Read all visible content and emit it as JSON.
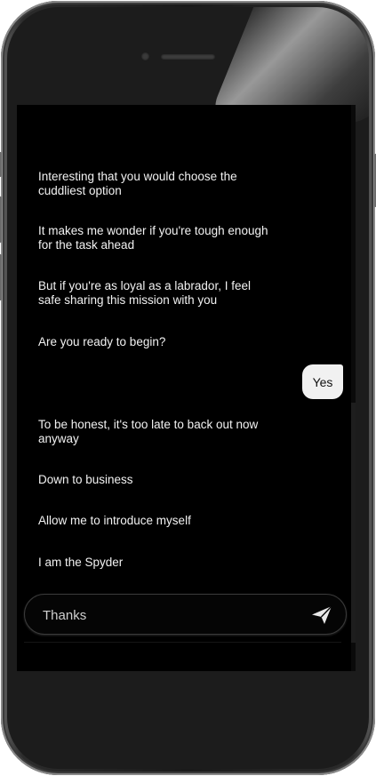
{
  "conversation": {
    "messages": [
      {
        "text": "Interesting that you would choose the cuddliest option"
      },
      {
        "text": "It makes me wonder if you're tough enough for the task ahead"
      },
      {
        "text": "But if you're as loyal as a labrador, I feel safe sharing this mission with you"
      },
      {
        "text": "Are you ready to begin?"
      },
      {
        "text": "To be honest, it's too late to back out now anyway"
      },
      {
        "text": "Down to business"
      },
      {
        "text": "Allow me to introduce myself"
      },
      {
        "text": "I am the Spyder"
      }
    ],
    "user_reply": "Yes"
  },
  "composer": {
    "value": "Thanks",
    "send_icon": "send-icon"
  },
  "colors": {
    "screen_background": "#000000",
    "bot_text": "#f2f2f2",
    "user_bubble": "#f1f1f1",
    "user_text": "#111111"
  }
}
